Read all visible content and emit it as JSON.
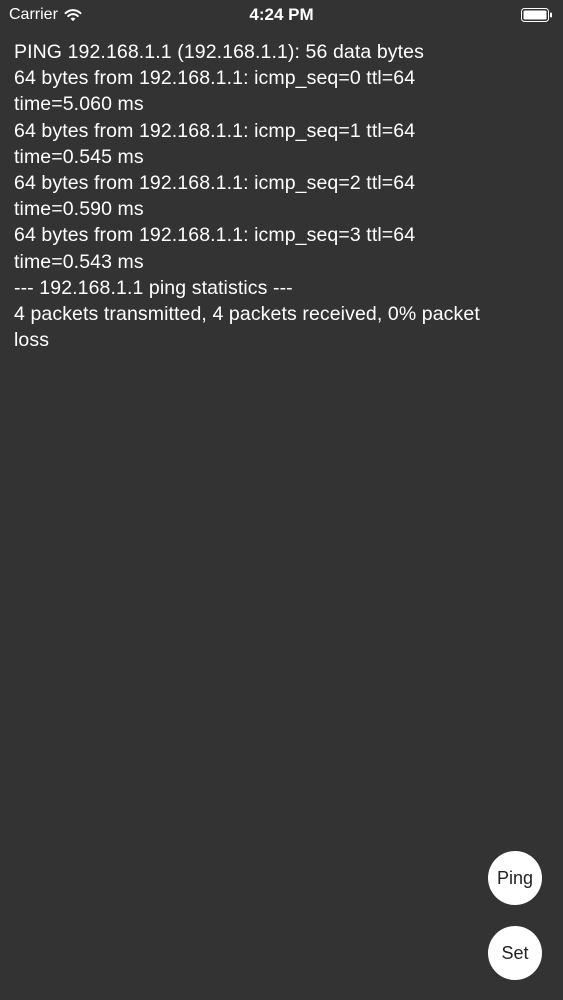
{
  "status_bar": {
    "carrier": "Carrier",
    "time": "4:24 PM",
    "wifi_icon": "wifi-icon",
    "battery_icon": "battery-full-icon"
  },
  "output": {
    "lines": [
      "PING 192.168.1.1 (192.168.1.1): 56 data bytes",
      "64 bytes from 192.168.1.1: icmp_seq=0 ttl=64",
      "time=5.060 ms",
      "64 bytes from 192.168.1.1: icmp_seq=1 ttl=64",
      "time=0.545 ms",
      "64 bytes from 192.168.1.1: icmp_seq=2 ttl=64",
      "time=0.590 ms",
      "64 bytes from 192.168.1.1: icmp_seq=3 ttl=64",
      "time=0.543 ms",
      "--- 192.168.1.1 ping statistics ---",
      "4 packets transmitted, 4 packets received, 0% packet",
      "loss"
    ]
  },
  "buttons": {
    "ping_label": "Ping",
    "set_label": "Set"
  },
  "colors": {
    "background": "#333333",
    "text": "#ffffff",
    "button_bg": "#ffffff",
    "button_text": "#222222"
  }
}
